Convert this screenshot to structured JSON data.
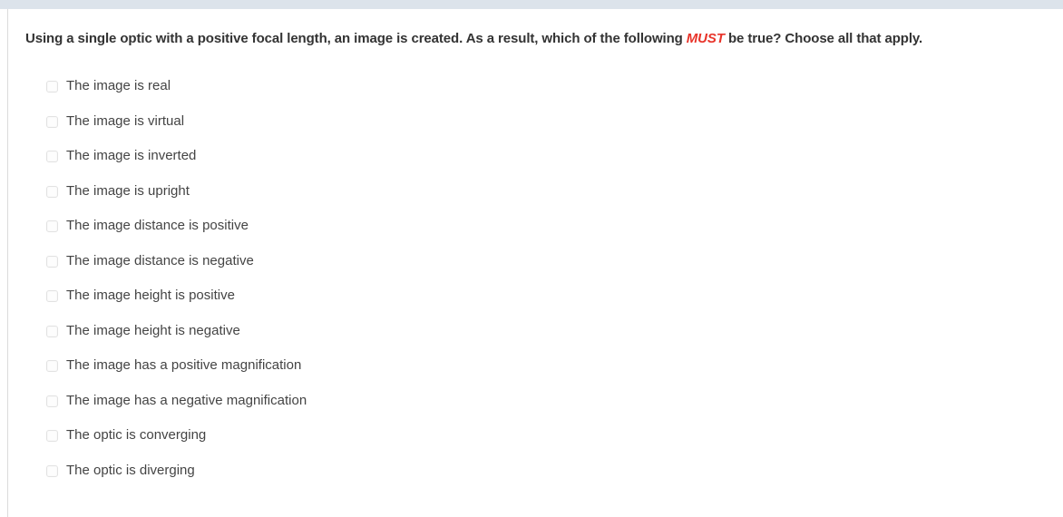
{
  "theme": {
    "top_bar_color": "#dce3eb",
    "panel_background": "#ffffff",
    "border_color": "#dcdcdc",
    "question_text_color": "#333333",
    "option_text_color": "#444444",
    "emphasis_color": "#e8342a",
    "checkbox_border_color": "#e2e2e2"
  },
  "question": {
    "part1": "Using a single optic with a positive focal length, an image is created. As a result, which of the following ",
    "emphasis": "MUST",
    "part2": " be true? Choose all that apply."
  },
  "options": [
    {
      "label": "The image is real",
      "checked": false
    },
    {
      "label": "The image is virtual",
      "checked": false
    },
    {
      "label": "The image is inverted",
      "checked": false
    },
    {
      "label": "The image is upright",
      "checked": false
    },
    {
      "label": "The image distance is positive",
      "checked": false
    },
    {
      "label": "The image distance is negative",
      "checked": false
    },
    {
      "label": "The image height is positive",
      "checked": false
    },
    {
      "label": "The image height is negative",
      "checked": false
    },
    {
      "label": "The image has a positive magnification",
      "checked": false
    },
    {
      "label": "The image has a negative magnification",
      "checked": false
    },
    {
      "label": "The optic is converging",
      "checked": false
    },
    {
      "label": "The optic is diverging",
      "checked": false
    }
  ]
}
